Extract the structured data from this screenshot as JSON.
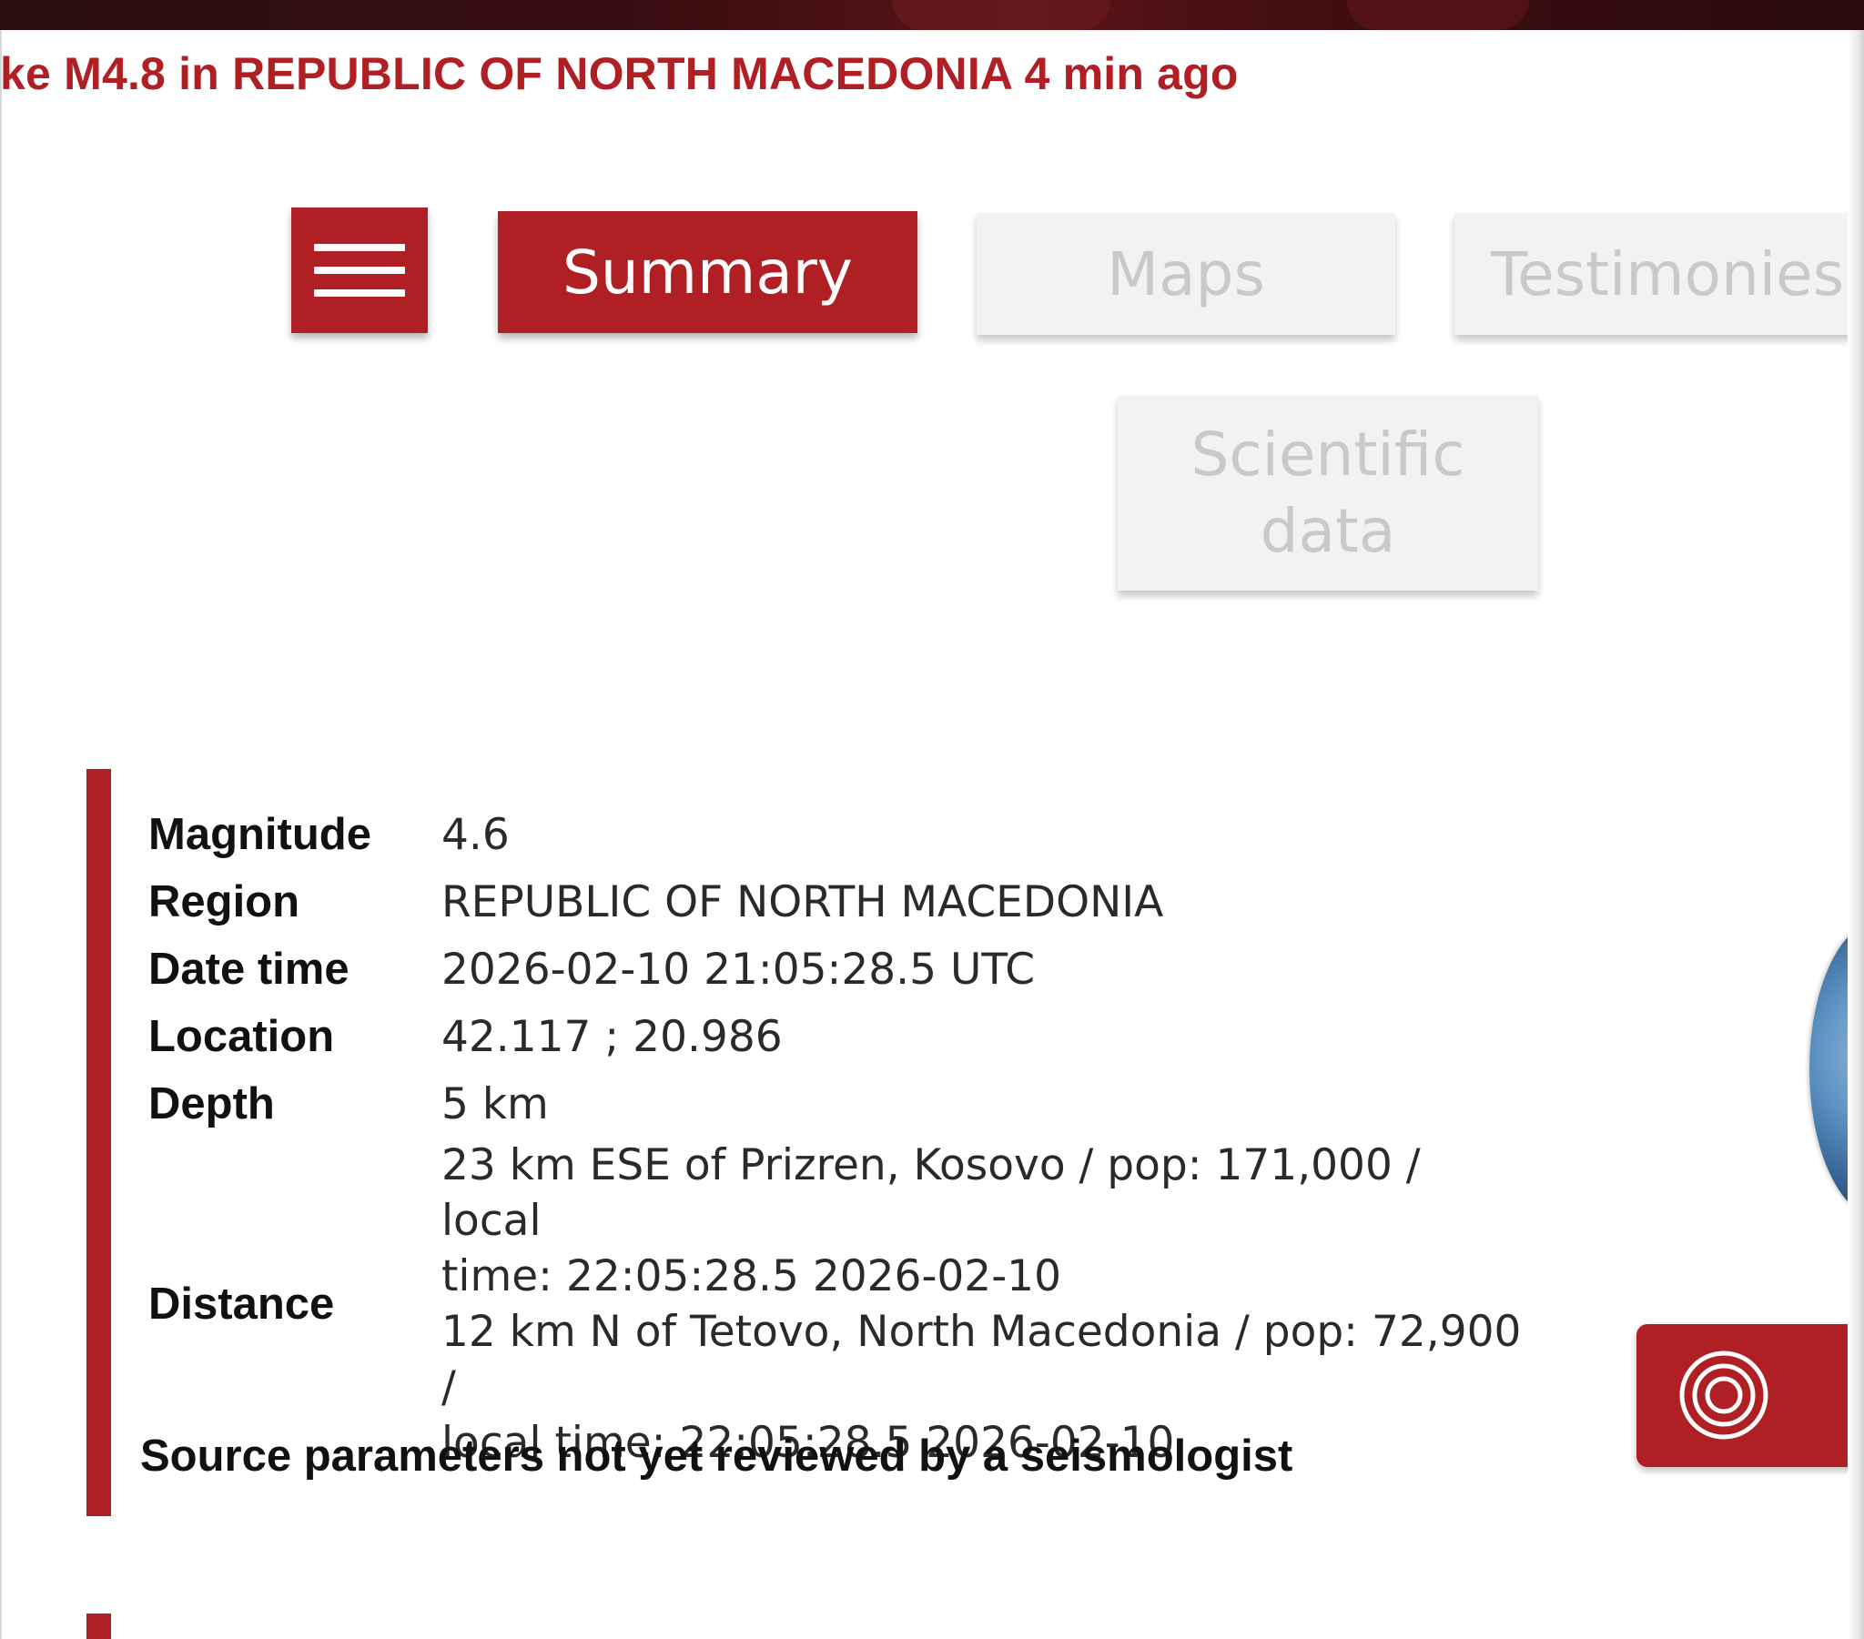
{
  "headline": "ke M4.8 in REPUBLIC OF NORTH MACEDONIA 4 min ago",
  "nav": {
    "menu_icon": "hamburger-menu-icon",
    "tabs": {
      "summary": "Summary",
      "maps": "Maps",
      "testimonies": "Testimonies",
      "scientific_line1": "Scientific",
      "scientific_line2": "data"
    }
  },
  "summary": {
    "magnitude_label": "Magnitude",
    "magnitude_value": "4.6",
    "region_label": "Region",
    "region_value": "REPUBLIC OF NORTH MACEDONIA",
    "datetime_label": "Date time",
    "datetime_value": "2026-02-10 21:05:28.5 UTC",
    "location_label": "Location",
    "location_value": "42.117 ; 20.986",
    "depth_label": "Depth",
    "depth_value": "5 km",
    "distance_label": "Distance",
    "distance_line1": "23 km ESE of Prizren, Kosovo / pop: 171,000 / local",
    "distance_line2": "time: 22:05:28.5 2026-02-10",
    "distance_line3": "12 km N of Tetovo, North Macedonia / pop: 72,900 /",
    "distance_line4": "local time: 22:05:28.5 2026-02-10",
    "review_note": "Source parameters not yet reviewed by a seismologist"
  },
  "colors": {
    "brand_red": "#b01f24",
    "inactive_tab_bg": "#f2f2f2",
    "inactive_tab_text": "#c9c9c9"
  },
  "icons": {
    "fab_icon": "seismic-rings-icon",
    "globe": "globe-icon"
  }
}
